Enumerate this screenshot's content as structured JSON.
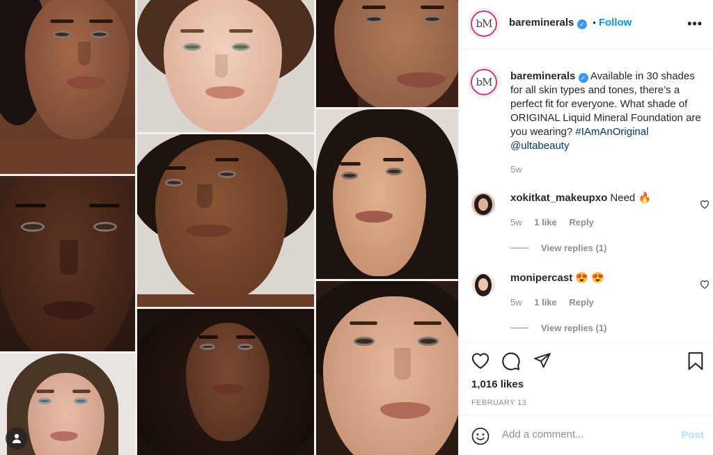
{
  "post": {
    "username": "bareminerals",
    "avatar_text": "bM",
    "verified": true,
    "follow_label": "Follow",
    "follow_separator": "•",
    "more_label": "•••",
    "caption_plain": "Available in 30 shades for all skin types and tones, there’s a perfect fit for everyone. What shade of ORIGINAL Liquid Mineral Foundation are you wearing?",
    "caption_hashtag": "#IAmAnOriginal",
    "caption_mention": "@ultabeauty",
    "caption_age": "5w"
  },
  "comments": [
    {
      "username": "xokitkat_makeupxo",
      "text": "Need",
      "emoji": "🔥",
      "age": "5w",
      "likes": "1 like",
      "reply_label": "Reply",
      "view_replies": "View replies (1)"
    },
    {
      "username": "monipercast",
      "text": "",
      "emoji": "😍 😍",
      "age": "5w",
      "likes": "1 like",
      "reply_label": "Reply",
      "view_replies": "View replies (1)"
    }
  ],
  "actions": {
    "like_icon": "heart-icon",
    "comment_icon": "comment-bubble-icon",
    "share_icon": "paper-plane-icon",
    "save_icon": "bookmark-icon",
    "likes_count": "1,016 likes",
    "date": "FEBRUARY 13"
  },
  "composer": {
    "emoji_icon": "smiley-icon",
    "placeholder": "Add a comment...",
    "post_label": "Post"
  },
  "media": {
    "tag_icon": "user-tag-icon"
  },
  "colors": {
    "link": "#0095f6",
    "hashtag": "#00376b",
    "muted": "#8e8e8e",
    "post_disabled": "#b2dffc",
    "avatar_ring": "#d6317a"
  }
}
